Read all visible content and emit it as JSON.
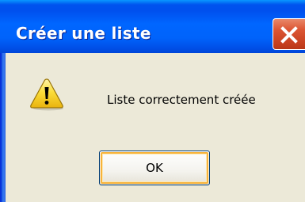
{
  "window": {
    "title": "Créer une liste",
    "close_icon": "close-icon"
  },
  "message": {
    "icon": "warning-icon",
    "text": "Liste correctement créée"
  },
  "buttons": {
    "ok_label": "OK"
  },
  "colors": {
    "titlebar": "#0058ee",
    "close_button": "#d9532f",
    "dialog_background": "#ece9d8",
    "button_focus": "#f8b33a",
    "warning_yellow": "#f7d329"
  }
}
